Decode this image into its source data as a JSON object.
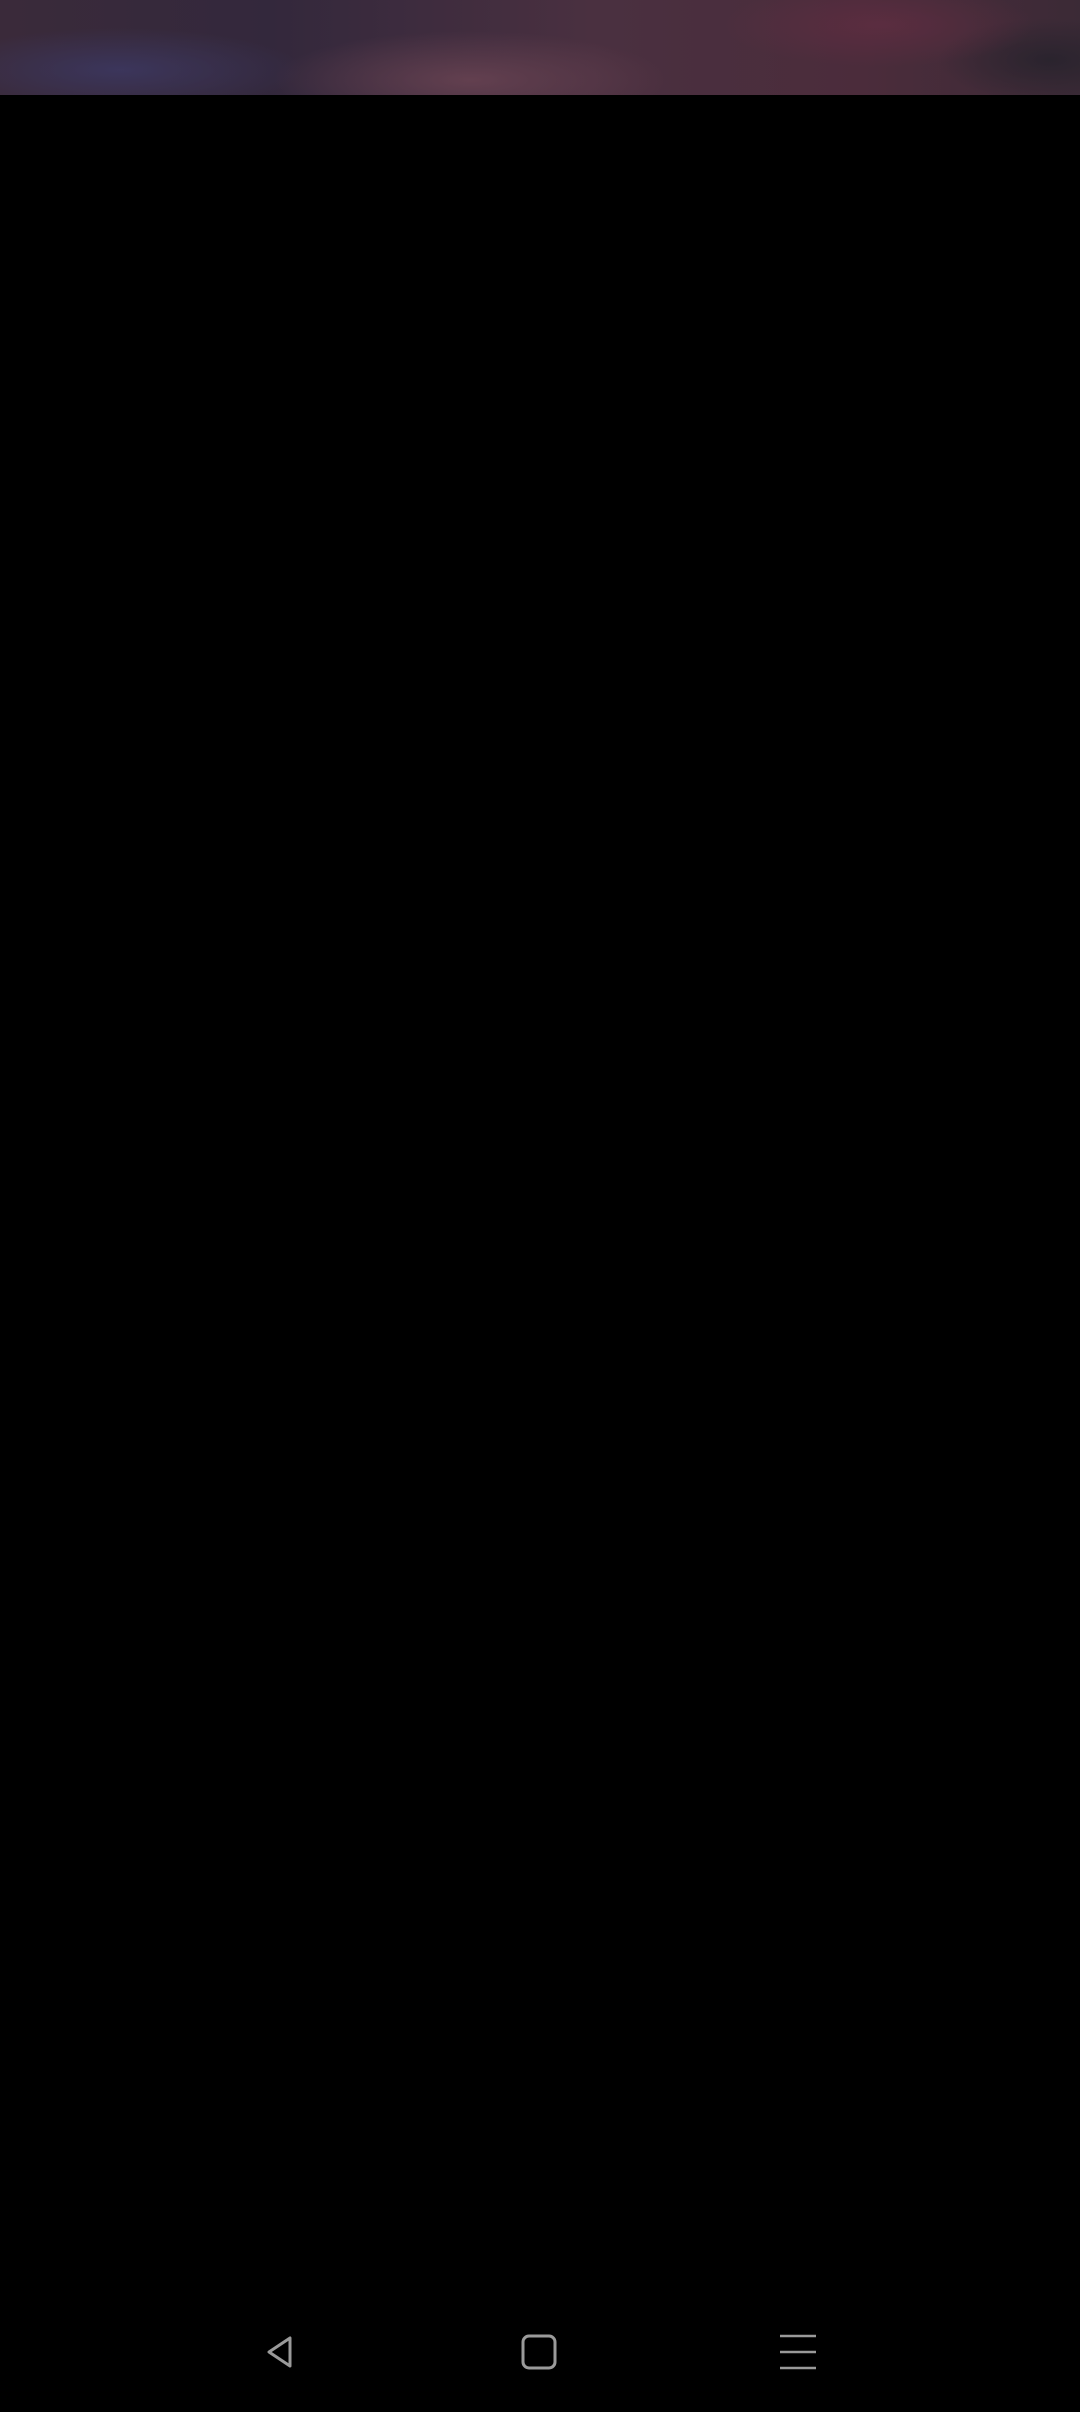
{
  "status_bar": {
    "colors": {
      "tint_left": "#33283c",
      "tint_mid": "#6e4655",
      "tint_right": "#4b2c3b"
    }
  },
  "content": {
    "background": "#000000"
  },
  "nav_bar": {
    "icon_color": "#9a9a9a",
    "buttons": [
      {
        "icon": "back-triangle-icon"
      },
      {
        "icon": "home-square-icon"
      },
      {
        "icon": "menu-lines-icon"
      }
    ]
  }
}
